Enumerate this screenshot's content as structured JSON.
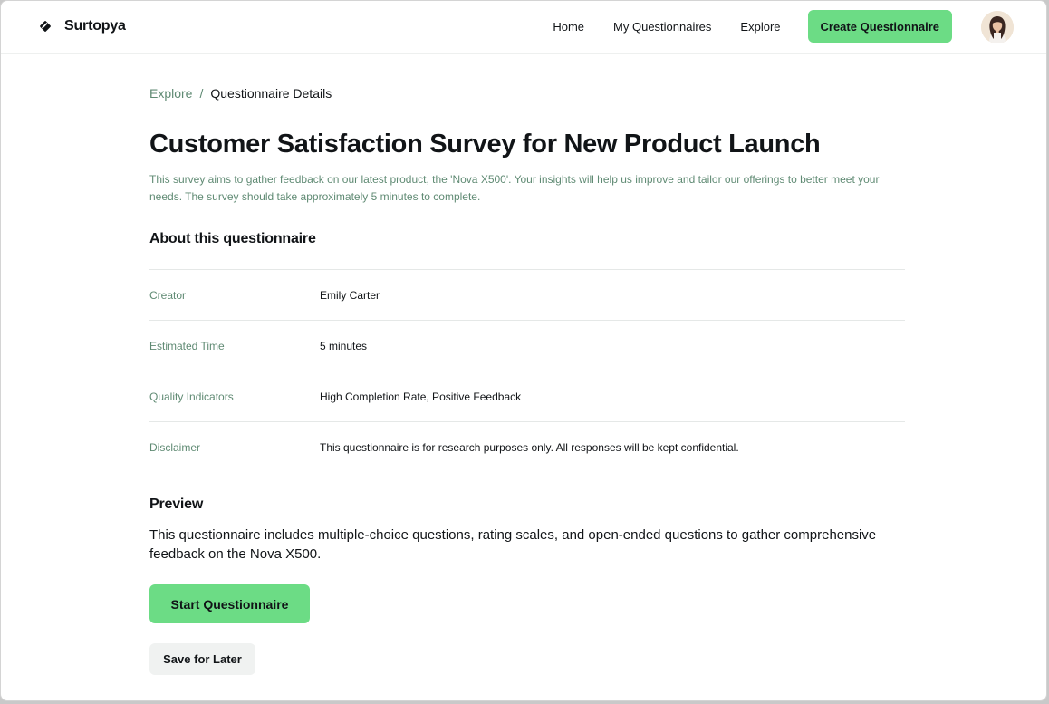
{
  "brand": {
    "name": "Surtopya",
    "icon": "diamond-logo-icon"
  },
  "nav": {
    "items": [
      "Home",
      "My Questionnaires",
      "Explore"
    ],
    "create_button": "Create Questionnaire",
    "avatar": "user-avatar"
  },
  "breadcrumb": {
    "parent": "Explore",
    "separator": "/",
    "current": "Questionnaire Details"
  },
  "questionnaire": {
    "title": "Customer Satisfaction Survey for New Product Launch",
    "description": "This survey aims to gather feedback on our latest product, the 'Nova X500'. Your insights will help us improve and tailor our offerings to better meet your needs. The survey should take approximately 5 minutes to complete."
  },
  "about": {
    "heading": "About this questionnaire",
    "rows": [
      {
        "label": "Creator",
        "value": "Emily Carter"
      },
      {
        "label": "Estimated Time",
        "value": "5 minutes"
      },
      {
        "label": "Quality Indicators",
        "value": "High Completion Rate, Positive Feedback"
      },
      {
        "label": "Disclaimer",
        "value": "This questionnaire is for research purposes only. All responses will be kept confidential."
      }
    ]
  },
  "preview": {
    "heading": "Preview",
    "text": "This questionnaire includes multiple-choice questions, rating scales, and open-ended questions to gather comprehensive feedback on the Nova X500."
  },
  "actions": {
    "start": "Start Questionnaire",
    "save": "Save for Later"
  },
  "colors": {
    "accent": "#6cdc85",
    "muted_text": "#5f8a73",
    "text": "#111417",
    "secondary_button": "#f0f2f1"
  }
}
